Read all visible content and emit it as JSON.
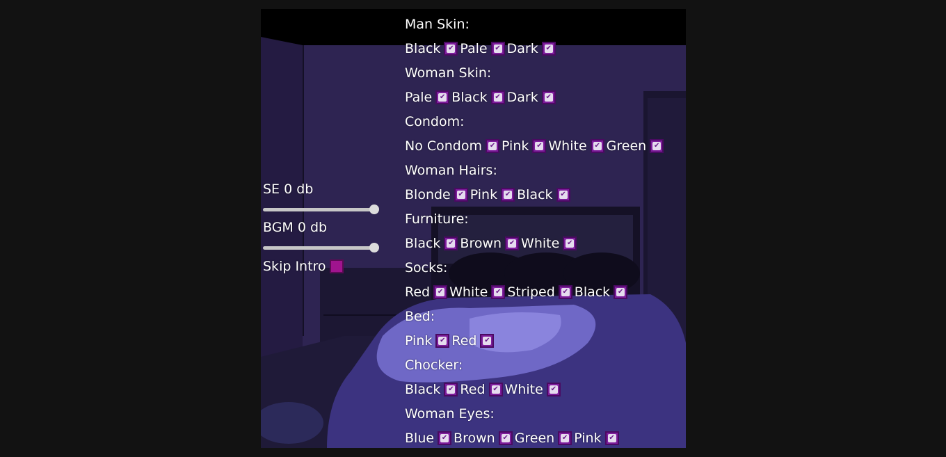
{
  "colors": {
    "checkbox_fill": "#7e1d9c",
    "checkbox_border": "#4a0a62",
    "checkbox_unchecked_fill": "#a0148e",
    "slider_track": "#c7c7c7",
    "text": "#ffffff",
    "room_wall": "#2e2452",
    "bed_sheet": "#6f68c6"
  },
  "audio": {
    "se_label": "SE  0 db",
    "se_level": 1.0,
    "bgm_label": "BGM 0 db",
    "bgm_level": 1.0,
    "skip_intro_label": "Skip Intro",
    "skip_intro_checked": false
  },
  "settings": [
    {
      "title": "Man Skin:",
      "options": [
        {
          "label": "Black",
          "checked": true
        },
        {
          "label": "Pale",
          "checked": true
        },
        {
          "label": "Dark",
          "checked": true
        }
      ]
    },
    {
      "title": "Woman Skin:",
      "options": [
        {
          "label": "Pale",
          "checked": true
        },
        {
          "label": "Black",
          "checked": true
        },
        {
          "label": "Dark",
          "checked": true
        }
      ]
    },
    {
      "title": "Condom:",
      "options": [
        {
          "label": "No Condom",
          "checked": true
        },
        {
          "label": "Pink",
          "checked": true
        },
        {
          "label": "White",
          "checked": true
        },
        {
          "label": "Green",
          "checked": true
        }
      ]
    },
    {
      "title": "Woman Hairs:",
      "options": [
        {
          "label": "Blonde",
          "checked": true
        },
        {
          "label": "Pink",
          "checked": true
        },
        {
          "label": "Black",
          "checked": true
        }
      ]
    },
    {
      "title": "Furniture:",
      "options": [
        {
          "label": "Black",
          "checked": true
        },
        {
          "label": "Brown",
          "checked": true
        },
        {
          "label": "White",
          "checked": true
        }
      ]
    },
    {
      "title": "Socks:",
      "options": [
        {
          "label": "Red",
          "checked": true
        },
        {
          "label": "White",
          "checked": true
        },
        {
          "label": "Striped",
          "checked": true
        },
        {
          "label": "Black",
          "checked": true
        }
      ]
    },
    {
      "title": "Bed:",
      "options": [
        {
          "label": "Pink",
          "checked": true
        },
        {
          "label": "Red",
          "checked": true
        }
      ]
    },
    {
      "title": "Chocker:",
      "options": [
        {
          "label": "Black",
          "checked": true
        },
        {
          "label": "Red",
          "checked": true
        },
        {
          "label": "White",
          "checked": true
        }
      ]
    },
    {
      "title": "Woman Eyes:",
      "options": [
        {
          "label": "Blue",
          "checked": true
        },
        {
          "label": "Brown",
          "checked": true
        },
        {
          "label": "Green",
          "checked": true
        },
        {
          "label": "Pink",
          "checked": true
        }
      ]
    }
  ]
}
